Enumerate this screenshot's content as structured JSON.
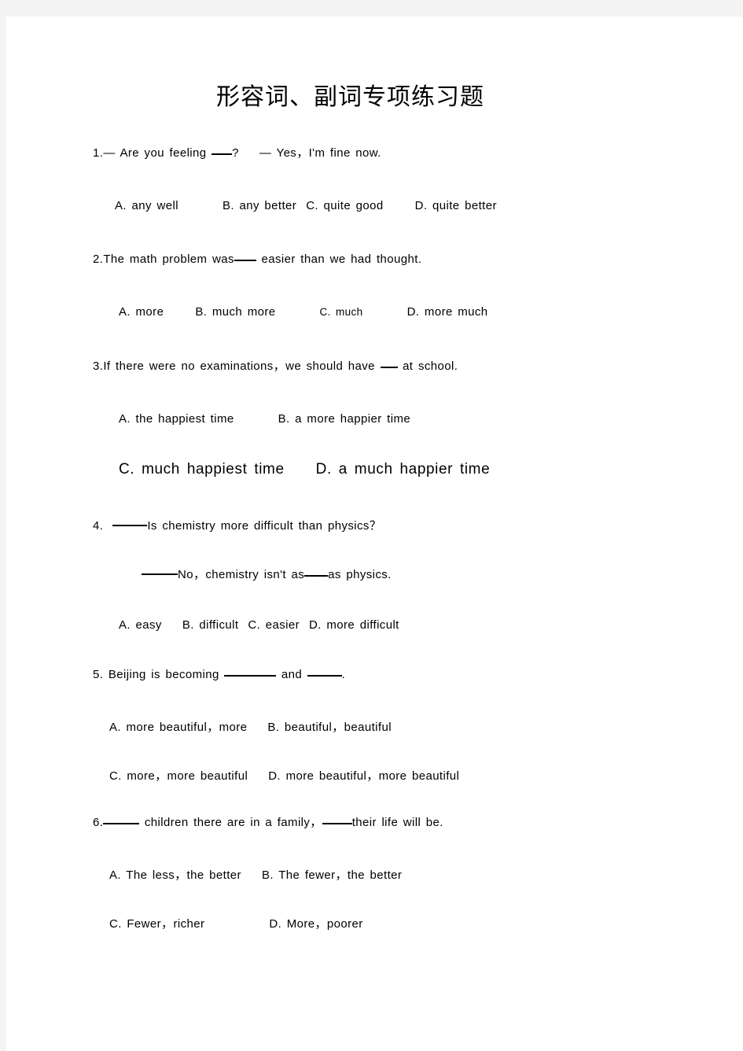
{
  "document": {
    "title": "形容词、副词专项练习题",
    "page_background": "#ffffff",
    "surround_background": "#f4f4f4",
    "text_color": "#000000"
  },
  "questions": [
    {
      "number": "1.",
      "stem_pre": "— Are you feeling ",
      "stem_post": "?",
      "stem_tail": "— Yes，I'm fine now.",
      "options": [
        {
          "label": "A. any well"
        },
        {
          "label": "B. any better"
        },
        {
          "label": "C. quite good"
        },
        {
          "label": "D. quite better"
        }
      ]
    },
    {
      "number": "2.",
      "stem_pre": "The math problem was",
      "stem_post": " easier than we had thought.",
      "options": [
        {
          "label": "A. more"
        },
        {
          "label": "B. much more"
        },
        {
          "label": "C. much"
        },
        {
          "label": "D. more much"
        }
      ]
    },
    {
      "number": "3.",
      "stem_pre": "If there were no examinations，we should have ",
      "stem_post": " at school.",
      "options": [
        {
          "label": "A. the happiest time"
        },
        {
          "label": "B. a more happier time"
        },
        {
          "label": "C. much happiest time"
        },
        {
          "label": "D. a much happier time"
        }
      ]
    },
    {
      "number": "4.",
      "line1": "Is chemistry more difficult than physics？",
      "line2_pre": "No，chemistry isn't as",
      "line2_post": "as physics.",
      "options": [
        {
          "label": "A. easy"
        },
        {
          "label": "B. difficult"
        },
        {
          "label": "C. easier"
        },
        {
          "label": "D. more difficult"
        }
      ]
    },
    {
      "number": "5.",
      "stem_pre": " Beijing is becoming ",
      "stem_mid": " and ",
      "stem_post": ".",
      "options": [
        {
          "label": "A. more beautiful，more"
        },
        {
          "label": "B. beautiful，beautiful"
        },
        {
          "label": "C. more，more beautiful"
        },
        {
          "label": "D. more beautiful，more beautiful"
        }
      ]
    },
    {
      "number": "6.",
      "stem_pre": " children there are in a family，",
      "stem_post": "their life will be.",
      "options": [
        {
          "label": "A. The less，the better"
        },
        {
          "label": "B. The fewer，the better"
        },
        {
          "label": "C. Fewer，richer"
        },
        {
          "label": "D. More，poorer"
        }
      ]
    }
  ]
}
